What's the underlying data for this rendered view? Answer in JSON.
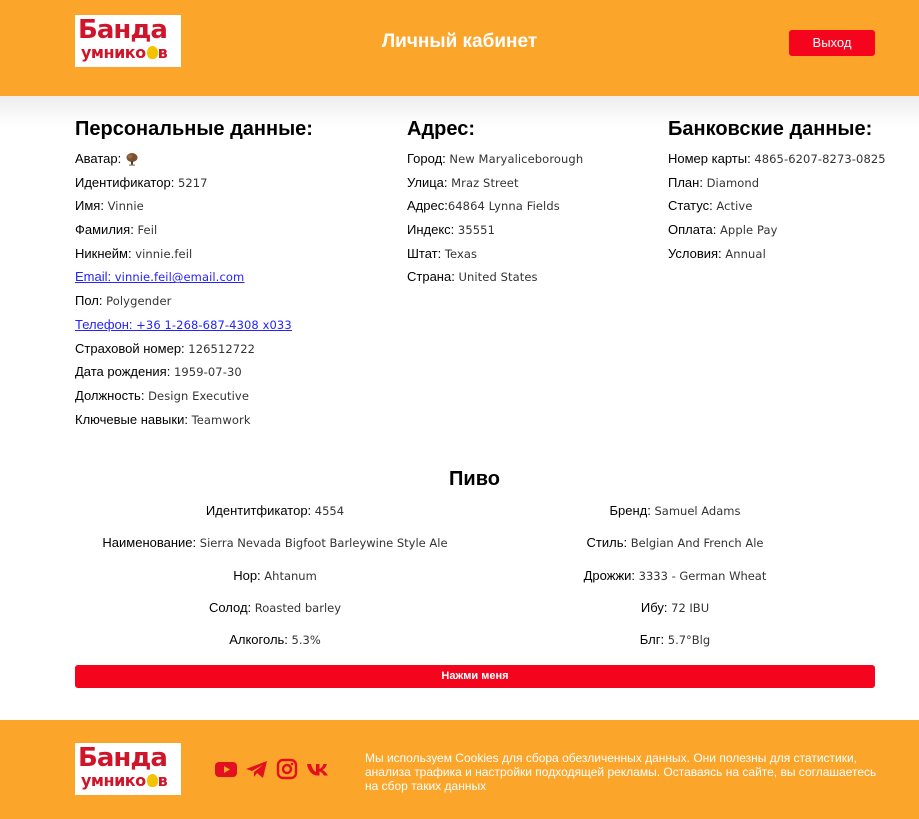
{
  "header": {
    "logo_line1": "Банда",
    "logo_line2": "умнико",
    "logo_line2_end": "в",
    "title": "Личный кабинет",
    "logout_label": "Выход"
  },
  "personal": {
    "heading": "Персональные данные:",
    "rows": [
      {
        "label": "Аватар:",
        "value": ""
      },
      {
        "label": "Идентификатор:",
        "value": "5217"
      },
      {
        "label": "Имя:",
        "value": "Vinnie"
      },
      {
        "label": "Фамилия:",
        "value": "Feil"
      },
      {
        "label": "Никнейм:",
        "value": "vinnie.feil"
      },
      {
        "label": "Email:",
        "value": "vinnie.feil@email.com"
      },
      {
        "label": "Пол:",
        "value": "Polygender"
      },
      {
        "label": "Телефон:",
        "value": "+36 1-268-687-4308 x033"
      },
      {
        "label": "Страховой номер:",
        "value": "126512722"
      },
      {
        "label": "Дата рождения:",
        "value": "1959-07-30"
      },
      {
        "label": "Должность:",
        "value": "Design Executive"
      },
      {
        "label": "Ключевые навыки:",
        "value": "Teamwork"
      }
    ]
  },
  "address": {
    "heading": "Адрес:",
    "rows": [
      {
        "label": "Город:",
        "value": "New Maryaliceborough"
      },
      {
        "label": "Улица:",
        "value": "Mraz Street"
      },
      {
        "label": "Адрес:",
        "value": "64864 Lynna Fields"
      },
      {
        "label": "Индекс:",
        "value": "35551"
      },
      {
        "label": "Штат:",
        "value": "Texas"
      },
      {
        "label": "Страна:",
        "value": "United States"
      }
    ]
  },
  "bank": {
    "heading": "Банковские данные:",
    "rows": [
      {
        "label": "Номер карты:",
        "value": "4865-6207-8273-0825"
      },
      {
        "label": "План:",
        "value": "Diamond"
      },
      {
        "label": "Статус:",
        "value": "Active"
      },
      {
        "label": "Оплата:",
        "value": "Apple Pay"
      },
      {
        "label": "Условия:",
        "value": "Annual"
      }
    ]
  },
  "beer": {
    "heading": "Пиво",
    "left": [
      {
        "label": "Идентитфикатор:",
        "value": "4554"
      },
      {
        "label": "Наименование:",
        "value": "Sierra Nevada Bigfoot Barleywine Style Ale"
      },
      {
        "label": "Hop:",
        "value": "Ahtanum"
      },
      {
        "label": "Солод:",
        "value": "Roasted barley"
      },
      {
        "label": "Алкоголь:",
        "value": "5.3%"
      }
    ],
    "right": [
      {
        "label": "Бренд:",
        "value": "Samuel Adams"
      },
      {
        "label": "Стиль:",
        "value": "Belgian And French Ale"
      },
      {
        "label": "Дрожжи:",
        "value": "3333 - German Wheat"
      },
      {
        "label": "Ибу:",
        "value": "72 IBU"
      },
      {
        "label": "Блг:",
        "value": "5.7°Blg"
      }
    ],
    "button_label": "Нажми меня"
  },
  "footer": {
    "cookie_text": "Мы используем Cookies для сбора обезличенных данных. Они полезны для статистики, анализа трафика и настройки подходящей рекламы. Оставаясь на сайте, вы соглашаетесь на сбор таких данных",
    "social_icons": [
      "youtube-icon",
      "telegram-icon",
      "instagram-icon",
      "vk-icon"
    ]
  },
  "colors": {
    "brand_orange": "#fca52b",
    "accent_red": "#f5051d",
    "logo_red": "#d0152b",
    "link_blue": "#2323ff"
  }
}
